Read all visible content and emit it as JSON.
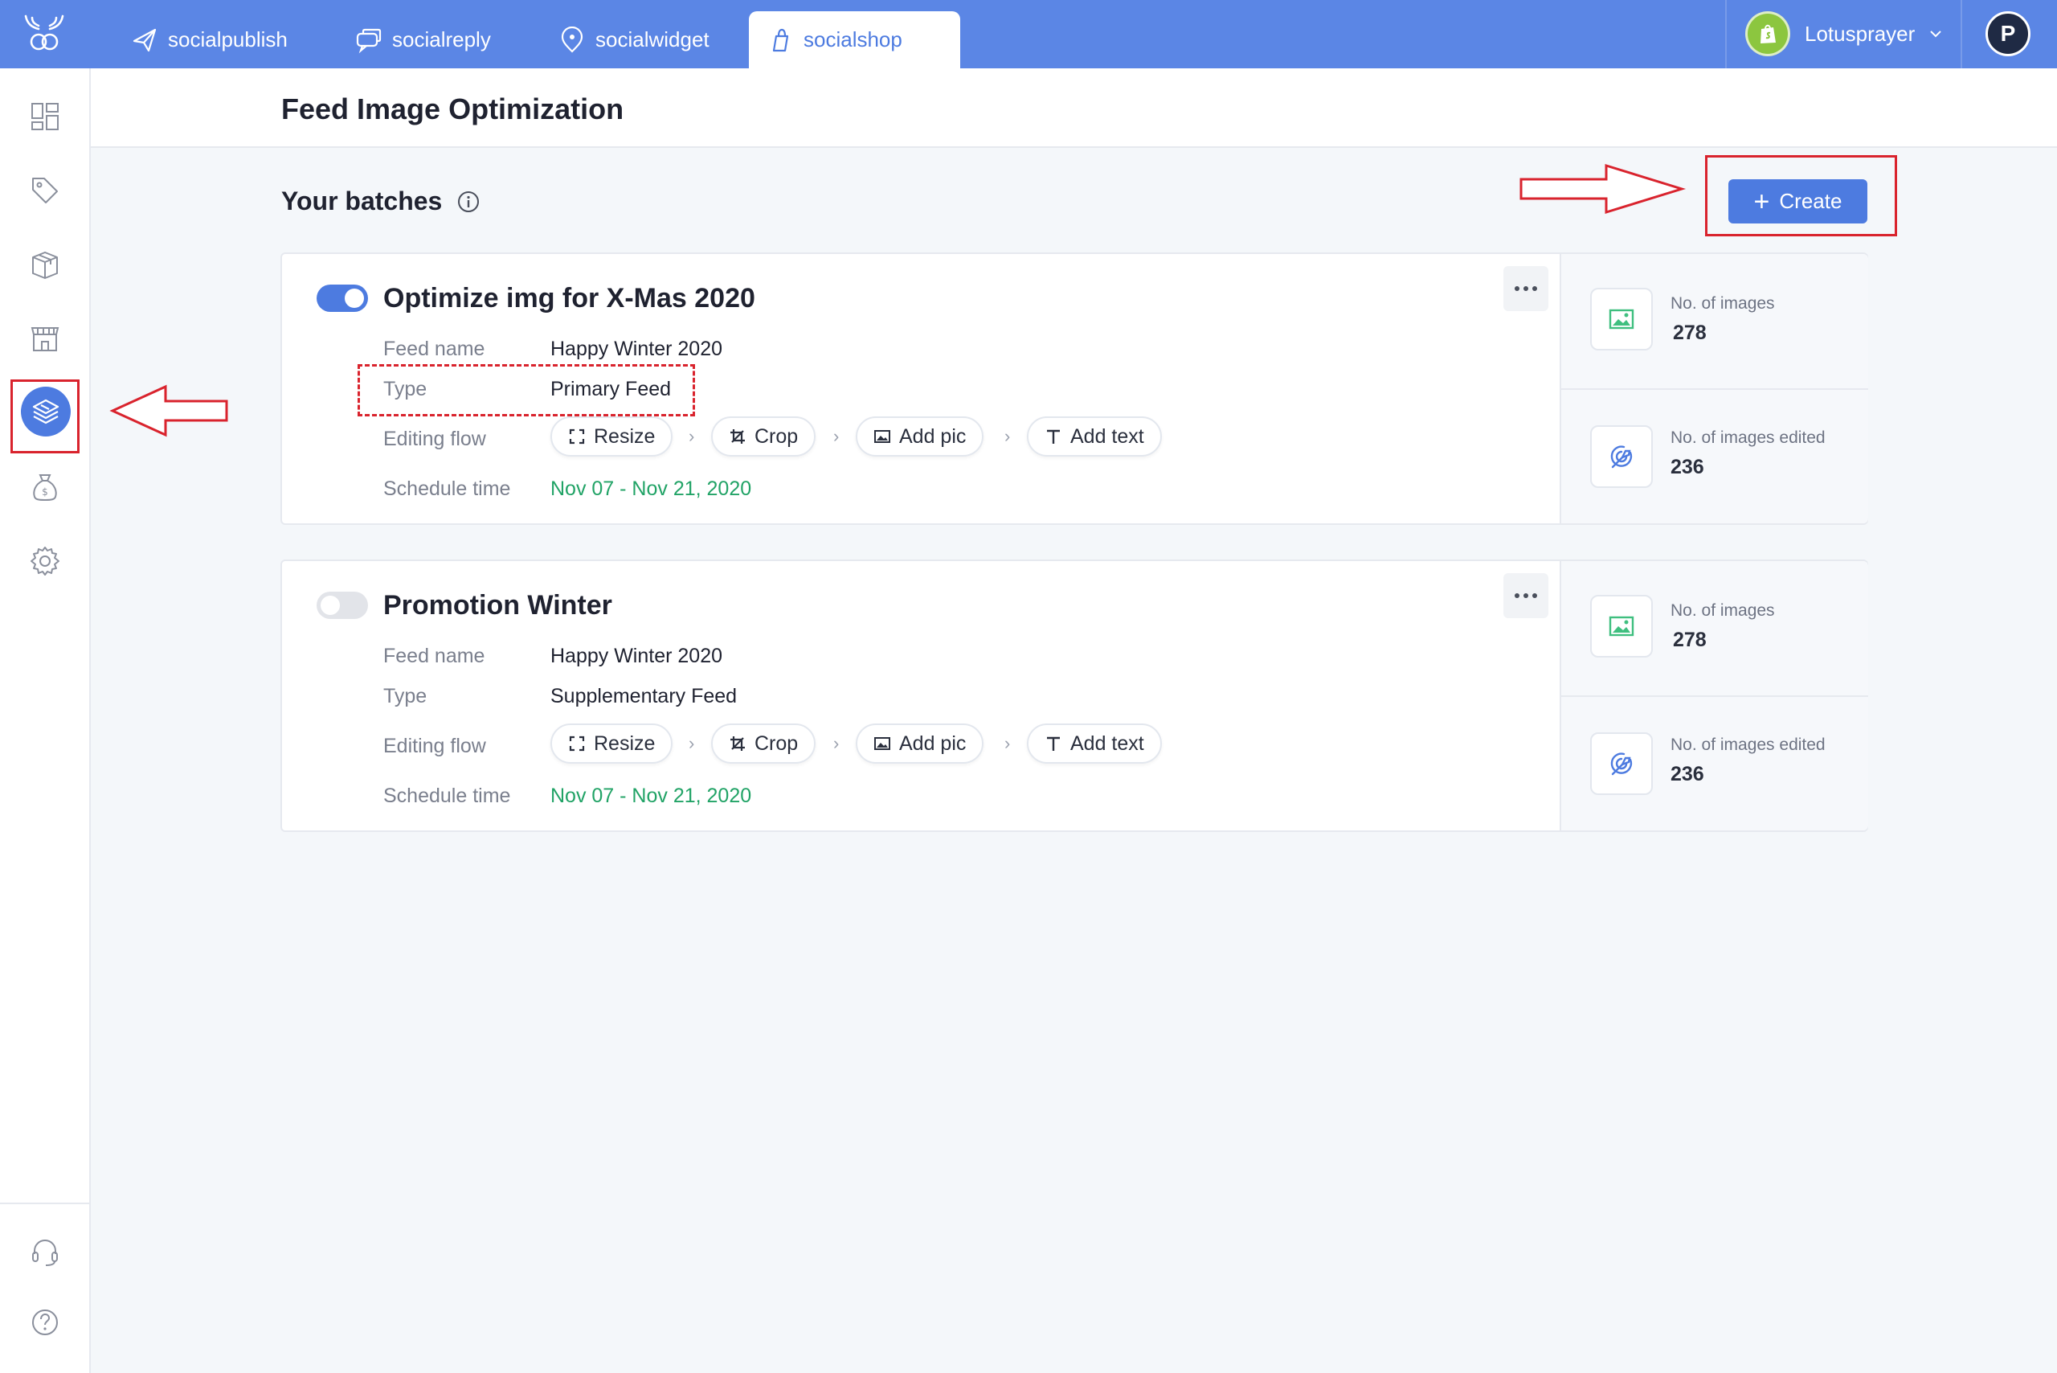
{
  "nav": {
    "tabs": [
      {
        "label": "socialpublish",
        "icon": "paper-plane-icon"
      },
      {
        "label": "socialreply",
        "icon": "chat-bubbles-icon"
      },
      {
        "label": "socialwidget",
        "icon": "location-pin-icon"
      },
      {
        "label": "socialshop",
        "icon": "shopping-bag-icon",
        "active": true
      }
    ],
    "store_name": "Lotusprayer",
    "avatar_initial": "P"
  },
  "sidebar": {
    "items": [
      {
        "icon": "dashboard-icon"
      },
      {
        "icon": "tag-icon"
      },
      {
        "icon": "box-icon"
      },
      {
        "icon": "store-icon"
      },
      {
        "icon": "layers-icon",
        "active": true
      },
      {
        "icon": "money-bag-icon"
      },
      {
        "icon": "gear-icon"
      }
    ],
    "bottom_items": [
      {
        "icon": "headset-icon"
      },
      {
        "icon": "help-icon"
      }
    ]
  },
  "page": {
    "title": "Feed Image Optimization",
    "section_title": "Your batches",
    "create_label": "Create"
  },
  "labels": {
    "feed_name": "Feed name",
    "type": "Type",
    "editing_flow": "Editing flow",
    "schedule_time": "Schedule time",
    "no_images": "No. of images",
    "no_images_edited": "No. of images edited"
  },
  "batches": [
    {
      "title": "Optimize img for X-Mas 2020",
      "enabled": true,
      "feed_name": "Happy Winter 2020",
      "type": "Primary Feed",
      "flow": [
        "Resize",
        "Crop",
        "Add pic",
        "Add text"
      ],
      "schedule": "Nov 07 - Nov 21, 2020",
      "images": "278",
      "images_edited": "236"
    },
    {
      "title": "Promotion Winter",
      "enabled": false,
      "feed_name": "Happy Winter 2020",
      "type": "Supplementary Feed",
      "flow": [
        "Resize",
        "Crop",
        "Add pic",
        "Add text"
      ],
      "schedule": "Nov 07 - Nov 21, 2020",
      "images": "278",
      "images_edited": "236"
    }
  ],
  "colors": {
    "primary": "#4d7be0",
    "topbar": "#5b86e5",
    "date_green": "#21a366",
    "annotation_red": "#d9232d"
  }
}
